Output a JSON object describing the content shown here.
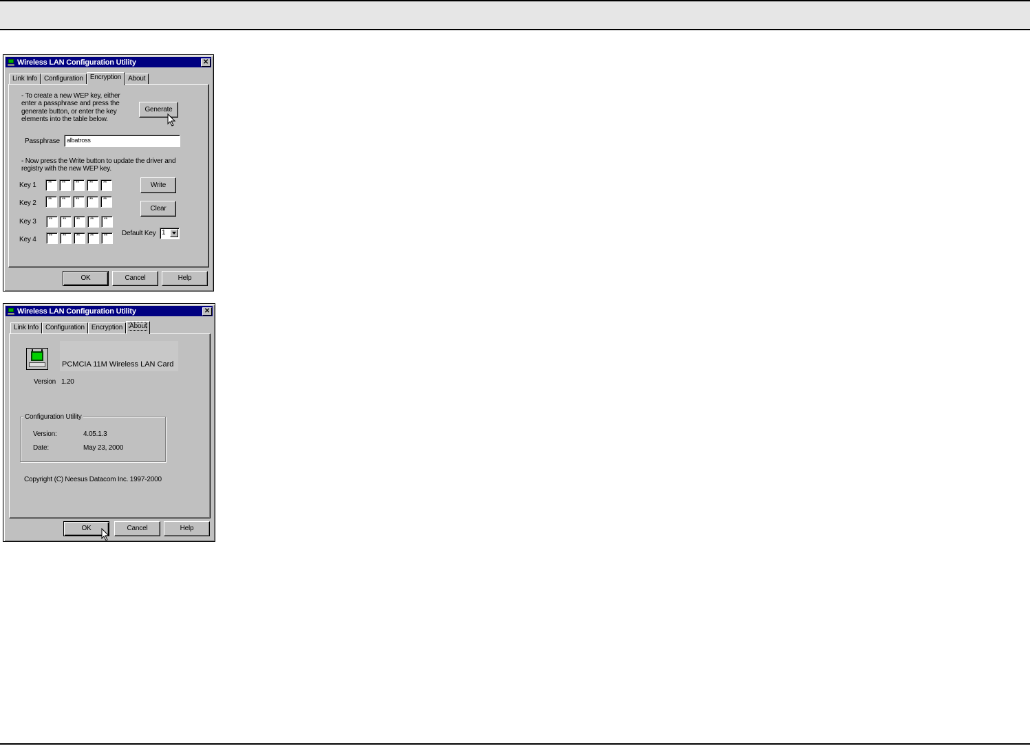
{
  "dialog1": {
    "title": "Wireless LAN Configuration Utility",
    "tabs": [
      "Link Info",
      "Configuration",
      "Encryption",
      "About"
    ],
    "active_tab": "Encryption",
    "instructions1": [
      "- To create a new WEP key, either",
      "enter a passphrase and press the",
      "generate button, or enter the key",
      "elements into the table below."
    ],
    "generate_label": "Generate",
    "passphrase_label": "Passphrase",
    "passphrase_value": "albatross",
    "instructions2": [
      "- Now press the Write button to update the driver and",
      "registry with the new WEP key."
    ],
    "keys": [
      {
        "label": "Key 1",
        "values": [
          "**",
          "**",
          "**",
          "**",
          "**"
        ]
      },
      {
        "label": "Key 2",
        "values": [
          "**",
          "**",
          "**",
          "**",
          "**"
        ]
      },
      {
        "label": "Key 3",
        "values": [
          "**",
          "**",
          "**",
          "**",
          "**"
        ]
      },
      {
        "label": "Key 4",
        "values": [
          "**",
          "**",
          "**",
          "**",
          "**"
        ]
      }
    ],
    "write_label": "Write",
    "clear_label": "Clear",
    "default_key_label": "Default Key",
    "default_key_value": "1",
    "ok_label": "OK",
    "cancel_label": "Cancel",
    "help_label": "Help"
  },
  "dialog2": {
    "title": "Wireless LAN Configuration Utility",
    "tabs": [
      "Link Info",
      "Configuration",
      "Encryption",
      "About"
    ],
    "active_tab": "About",
    "product_name": "PCMCIA 11M Wireless LAN Card",
    "version_label": "Version",
    "version_value": "1.20",
    "group_title": "Configuration Utility",
    "util_version_label": "Version:",
    "util_version_value": "4.05.1.3",
    "util_date_label": "Date:",
    "util_date_value": "May 23, 2000",
    "copyright": "Copyright (C) Neesus Datacom Inc. 1997-2000",
    "ok_label": "OK",
    "cancel_label": "Cancel",
    "help_label": "Help"
  }
}
